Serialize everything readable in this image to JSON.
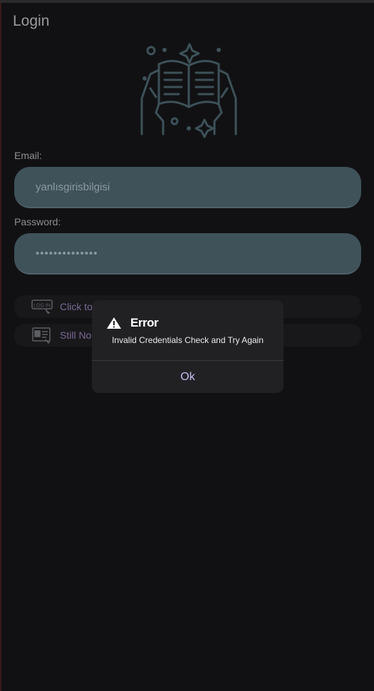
{
  "page": {
    "title": "Login",
    "icons": {
      "hero": "open-book-hands-icon"
    }
  },
  "form": {
    "email_label": "Email:",
    "email_value": "yanlısgirisbilgisi",
    "password_label": "Password:",
    "password_value": "••••••••••••••"
  },
  "buttons": [
    {
      "label": "Click to",
      "icon": "login-icon"
    },
    {
      "label": "Still No",
      "icon": "register-form-icon"
    }
  ],
  "dialog": {
    "title": "Error",
    "message": "Invalid Credentials Check and Try Again",
    "ok_label": "Ok",
    "icon": "warning-icon"
  },
  "colors": {
    "background": "#111113",
    "field": "#3f525a",
    "dialog": "#212124",
    "accent": "#cbbcf2",
    "button_text": "#7b6a94"
  }
}
